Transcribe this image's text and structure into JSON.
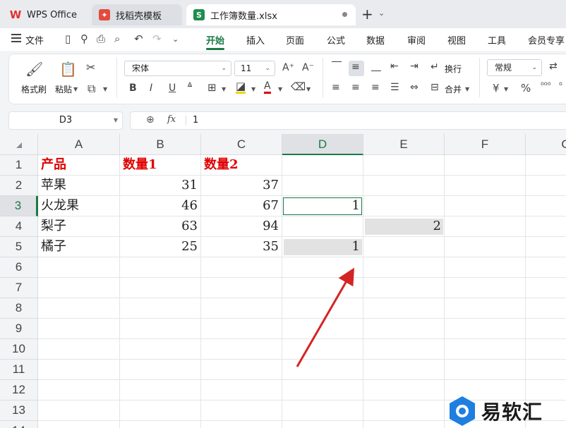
{
  "tabs": {
    "wps_label": "WPS Office",
    "template_label": "找稻壳模板",
    "workbook_label": "工作簿数量.xlsx",
    "workbook_icon_letter": "S",
    "new_tab": "+",
    "new_tab_menu": "⌄"
  },
  "menu": {
    "file": "文件",
    "tabs": [
      "开始",
      "插入",
      "页面",
      "公式",
      "数据",
      "审阅",
      "视图",
      "工具",
      "会员专享"
    ]
  },
  "ribbon": {
    "format_painter": "格式刷",
    "paste": "粘贴",
    "font_name": "宋体",
    "font_size": "11",
    "wrap_text": "换行",
    "merge": "合并",
    "number_format": "常规",
    "currency_symbol": "¥",
    "percent_symbol": "%",
    "bold": "B",
    "italic": "I",
    "underline": "U"
  },
  "formula_bar": {
    "name_box": "D3",
    "fx": "fx",
    "value": "1"
  },
  "sheet": {
    "columns": [
      "A",
      "B",
      "C",
      "D",
      "E",
      "F",
      "G"
    ],
    "rows": [
      "1",
      "2",
      "3",
      "4",
      "5",
      "6",
      "7",
      "8",
      "9",
      "10",
      "11",
      "12",
      "13",
      "14"
    ],
    "header_row": [
      "产品",
      "数量1",
      "数量2"
    ],
    "data": [
      {
        "product": "苹果",
        "q1": "31",
        "q2": "37",
        "d": "",
        "e": ""
      },
      {
        "product": "火龙果",
        "q1": "46",
        "q2": "67",
        "d": "1",
        "e": ""
      },
      {
        "product": "梨子",
        "q1": "63",
        "q2": "94",
        "d": "",
        "e": "2"
      },
      {
        "product": "橘子",
        "q1": "25",
        "q2": "35",
        "d": "1",
        "e": ""
      }
    ],
    "selected_cell": "D3",
    "header_color": "#e00000",
    "accent_color": "#1a7a45"
  },
  "watermark": {
    "text": "易软汇"
  }
}
